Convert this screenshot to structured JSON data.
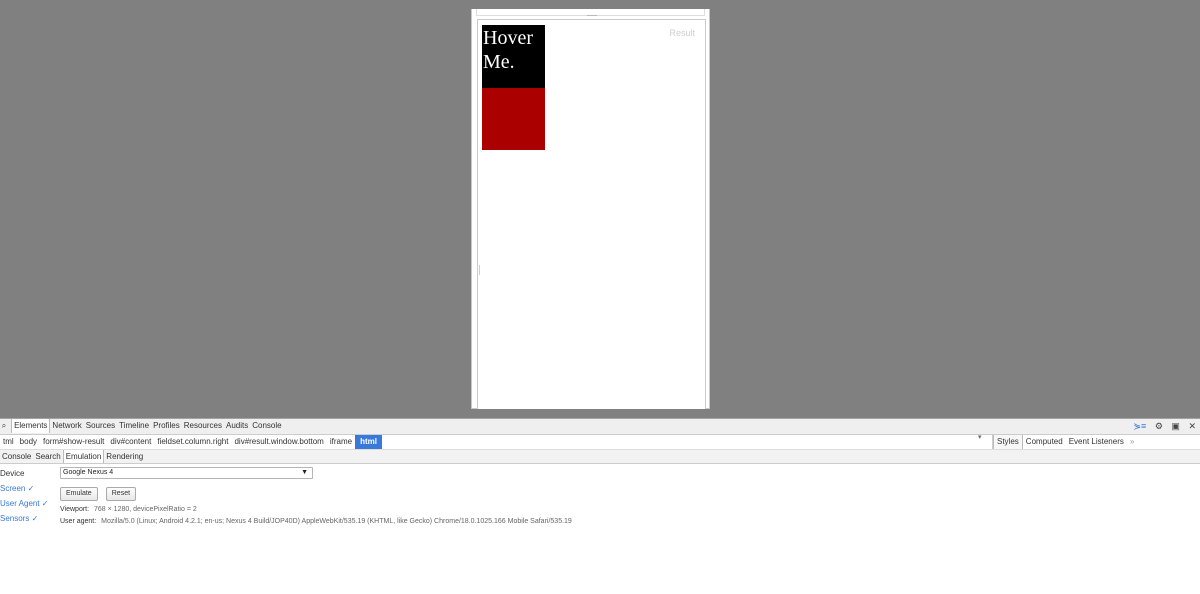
{
  "preview": {
    "result_label": "Result",
    "hover_text": "Hover Me."
  },
  "devtools": {
    "tabs": [
      "Elements",
      "Network",
      "Sources",
      "Timeline",
      "Profiles",
      "Resources",
      "Audits",
      "Console"
    ],
    "active_tab": "Elements",
    "breadcrumbs": [
      "tml",
      "body",
      "form#show-result",
      "div#content",
      "fieldset.column.right",
      "div#result.window.bottom",
      "iframe",
      "html"
    ],
    "selected_crumb": "html",
    "sidebar_tabs": [
      "Styles",
      "Computed",
      "Event Listeners"
    ],
    "sidebar_more": "»",
    "drawer_tabs": [
      "Console",
      "Search",
      "Emulation",
      "Rendering"
    ],
    "active_drawer_tab": "Emulation",
    "emulation": {
      "nav": [
        {
          "label": "Device",
          "checked": false
        },
        {
          "label": "Screen ✓",
          "checked": true
        },
        {
          "label": "User Agent ✓",
          "checked": true
        },
        {
          "label": "Sensors ✓",
          "checked": true
        }
      ],
      "device_value": "Google Nexus 4",
      "emulate_button": "Emulate",
      "reset_button": "Reset",
      "viewport_label": "Viewport:",
      "viewport_value": "768 × 1280, devicePixelRatio = 2",
      "useragent_label": "User agent:",
      "useragent_value": "Mozilla/5.0 (Linux; Android 4.2.1; en-us; Nexus 4 Build/JOP40D) AppleWebKit/535.19 (KHTML, like Gecko) Chrome/18.0.1025.166 Mobile Safari/535.19"
    }
  }
}
